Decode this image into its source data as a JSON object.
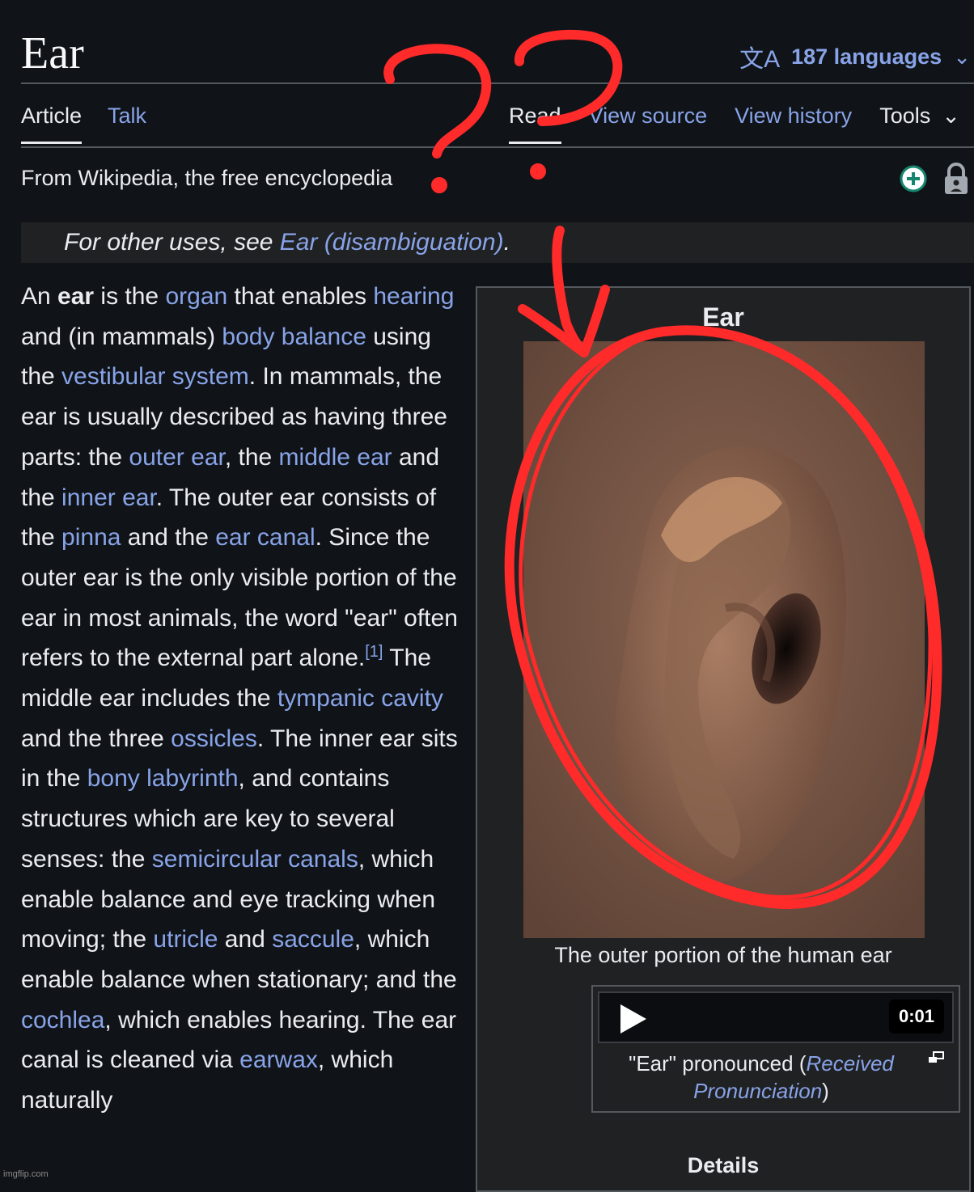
{
  "header": {
    "title": "Ear",
    "languages_label": "187 languages",
    "languages_icon": "translate-icon"
  },
  "tabs": {
    "left": [
      "Article",
      "Talk"
    ],
    "right": [
      "Read",
      "View source",
      "View history",
      "Tools"
    ]
  },
  "tagline": "From Wikipedia, the free encyclopedia",
  "hatnote": {
    "prefix": "For other uses, see ",
    "link": "Ear (disambiguation)",
    "suffix": "."
  },
  "body": {
    "segments": [
      {
        "t": "An "
      },
      {
        "t": "ear",
        "b": true
      },
      {
        "t": " is the "
      },
      {
        "t": "organ",
        "l": true
      },
      {
        "t": " that enables "
      },
      {
        "t": "hearing",
        "l": true
      },
      {
        "t": " and (in mammals) "
      },
      {
        "t": "body balance",
        "l": true
      },
      {
        "t": " using the "
      },
      {
        "t": "vestibular system",
        "l": true
      },
      {
        "t": ". In mammals, the ear is usually described as having three parts: the "
      },
      {
        "t": "outer ear",
        "l": true
      },
      {
        "t": ", the "
      },
      {
        "t": "middle ear",
        "l": true
      },
      {
        "t": " and the "
      },
      {
        "t": "inner ear",
        "l": true
      },
      {
        "t": ". The outer ear consists of the "
      },
      {
        "t": "pinna",
        "l": true
      },
      {
        "t": " and the "
      },
      {
        "t": "ear canal",
        "l": true
      },
      {
        "t": ". Since the outer ear is the only visible portion of the ear in most animals, the word \"ear\" often refers to the external part alone."
      },
      {
        "t": "[1]",
        "sup": true
      },
      {
        "t": " The middle ear includes the "
      },
      {
        "t": "tympanic cavity",
        "l": true
      },
      {
        "t": " and the three "
      },
      {
        "t": "ossicles",
        "l": true
      },
      {
        "t": ". The inner ear sits in the "
      },
      {
        "t": "bony labyrinth",
        "l": true
      },
      {
        "t": ", and contains structures which are key to several senses: the "
      },
      {
        "t": "semicircular canals",
        "l": true
      },
      {
        "t": ", which enable balance and eye tracking when moving; the "
      },
      {
        "t": "utricle",
        "l": true
      },
      {
        "t": " and "
      },
      {
        "t": "saccule",
        "l": true
      },
      {
        "t": ", which enable balance when stationary; and the "
      },
      {
        "t": "cochlea",
        "l": true
      },
      {
        "t": ", which enables hearing. The ear canal is cleaned via "
      },
      {
        "t": "earwax",
        "l": true
      },
      {
        "t": ", which naturally"
      }
    ]
  },
  "infobox": {
    "title": "Ear",
    "image_caption": "The outer portion of the human ear",
    "audio": {
      "time": "0:01",
      "caption_prefix": "\"Ear\" pronounced (",
      "caption_link": "Received Pronunciation",
      "caption_suffix": ")"
    },
    "details_label": "Details"
  },
  "watermark": "imgflip.com",
  "colors": {
    "background": "#101418",
    "link": "#88a3e8",
    "annotation": "#ff2a2a"
  }
}
